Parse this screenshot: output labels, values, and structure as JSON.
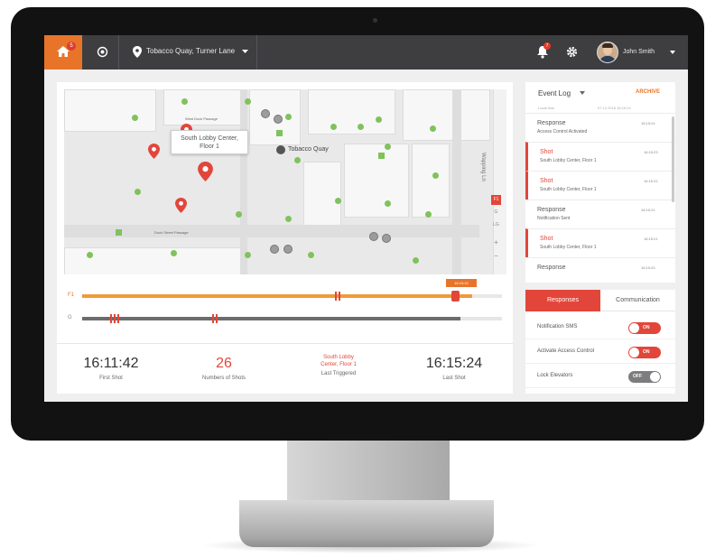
{
  "topbar": {
    "home_badge": "5",
    "location": "Tobacco Quay, Turner Lane",
    "bell_badge": "7",
    "user_name": "John Smith"
  },
  "map": {
    "tooltip_line1": "South Lobby Center,",
    "tooltip_line2": "Floor 1",
    "poi_label": "Tobacco Quay",
    "street_1": "Dock Street Passage",
    "street_2": "West Dock Passage",
    "vertical_street": "Wapping Ln",
    "floor_active": "F1",
    "floor_g": "G",
    "floor_lg": "LG",
    "zoom_in": "+",
    "zoom_out": "−"
  },
  "timeline": {
    "time_label": "16:15:24",
    "row1_label": "F1",
    "row2_label": "G",
    "f1_progress": 0.93,
    "g_progress": 0.9
  },
  "stats": {
    "first_shot_time": "16:11:42",
    "first_shot_label": "First Shot",
    "shots_count": "26",
    "shots_label": "Numbers of Shots",
    "last_triggered_line1": "South Lobby",
    "last_triggered_line2": "Center, Floor 1",
    "last_triggered_label": "Last Triggered",
    "last_shot_time": "16:15:24",
    "last_shot_label": "Last Shot"
  },
  "event_log": {
    "title": "Event Log",
    "archive": "ARCHIVE",
    "col_local_time": "Local time",
    "col_range": "07.12.2018 16:15:24",
    "items": [
      {
        "type": "Response",
        "desc": "Access Control Activated",
        "time": "16:15:24",
        "shot": false
      },
      {
        "type": "Shot",
        "desc": "South Lobby Center, Floor 1",
        "time": "16:15:23",
        "shot": true
      },
      {
        "type": "Shot",
        "desc": "South Lobby Center, Floor 1",
        "time": "16:15:22",
        "shot": true
      },
      {
        "type": "Response",
        "desc": "Notification Sent",
        "time": "16:15:21",
        "shot": false
      },
      {
        "type": "Shot",
        "desc": "South Lobby Center, Floor 1",
        "time": "16:15:21",
        "shot": true
      },
      {
        "type": "Response",
        "desc": "",
        "time": "16:15:20",
        "shot": false
      }
    ]
  },
  "responses": {
    "tab_responses": "Responses",
    "tab_communication": "Communication",
    "rows": [
      {
        "label": "Notification SMS",
        "state": "ON"
      },
      {
        "label": "Activate Access Control",
        "state": "ON"
      },
      {
        "label": "Lock Elevators",
        "state": "OFF"
      }
    ]
  },
  "colors": {
    "accent": "#e8742a",
    "alert": "#e2463a",
    "topbar": "#3e3e41",
    "marker": "#80c25b"
  }
}
